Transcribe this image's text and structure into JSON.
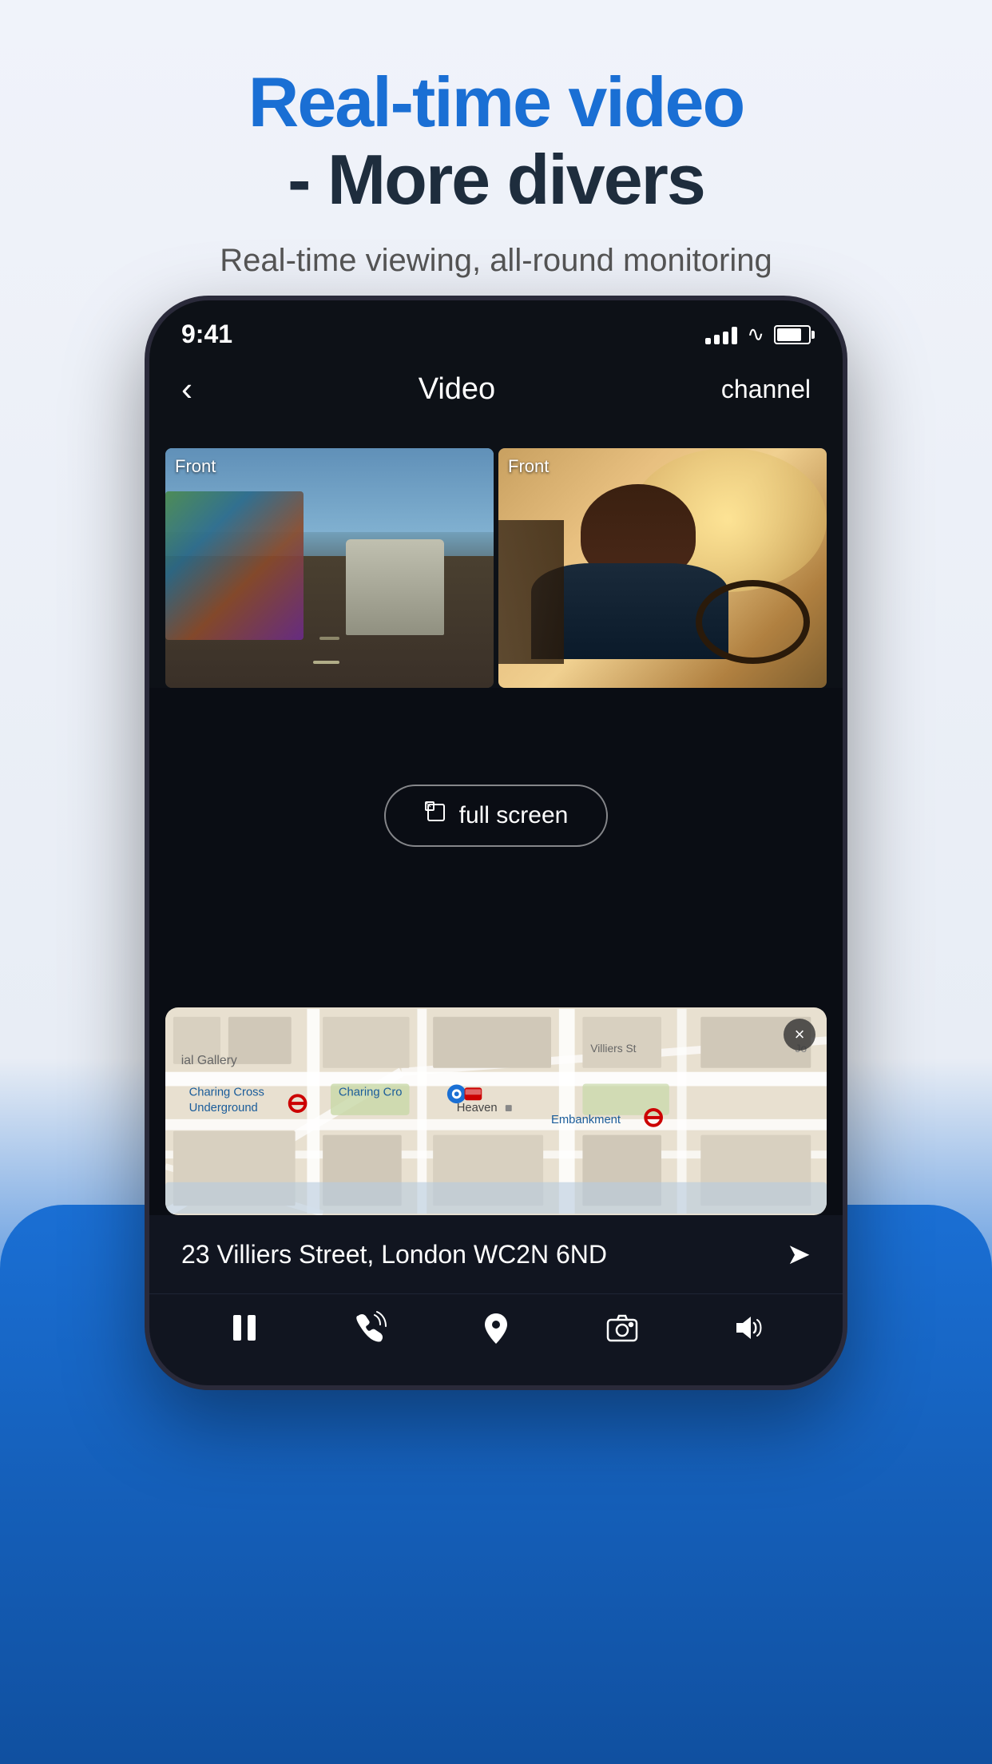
{
  "page": {
    "background_top": "#f0f3fa",
    "background_bottom": "#1050a0"
  },
  "header": {
    "headline_blue": "Real-time video",
    "headline_dark": "- More divers",
    "subtitle": "Real-time viewing, all-round monitoring"
  },
  "phone": {
    "status_bar": {
      "time": "9:41",
      "signal": "active",
      "wifi": "active",
      "battery": "80%"
    },
    "nav": {
      "back_icon": "‹",
      "title": "Video",
      "channel_label": "channel"
    },
    "video_grid": {
      "left": {
        "label": "Front",
        "scene": "traffic"
      },
      "right": {
        "label": "Front",
        "scene": "driver"
      }
    },
    "fullscreen_button": {
      "icon": "⛶",
      "label": "full screen"
    },
    "map": {
      "location": "23 Villiers Street, London WC2N 6ND",
      "close_icon": "×",
      "places": [
        "Charing Cross Underground",
        "Charing Cro",
        "Heaven",
        "Embankment"
      ]
    },
    "controls": [
      {
        "name": "pause",
        "icon": "⏸"
      },
      {
        "name": "phone",
        "icon": "📞"
      },
      {
        "name": "location",
        "icon": "📍"
      },
      {
        "name": "camera",
        "icon": "📷"
      },
      {
        "name": "volume",
        "icon": "🔊"
      }
    ]
  }
}
